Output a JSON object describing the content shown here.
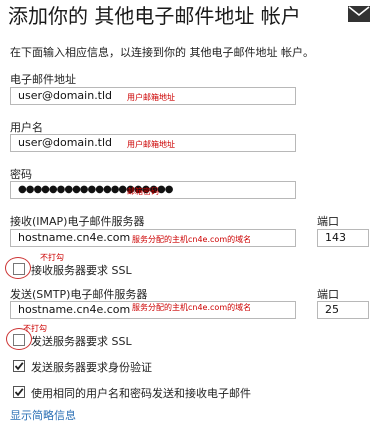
{
  "header": {
    "title": "添加你的 其他电子邮件地址 帐户",
    "mail_icon": "mail-envelope-icon"
  },
  "description": "在下面输入相应信息，以连接到你的 其他电子邮件地址 帐户。",
  "email": {
    "label": "电子邮件地址",
    "value": "user@domain.tld",
    "annotation": "用户邮箱地址"
  },
  "username": {
    "label": "用户名",
    "value": "user@domain.tld",
    "annotation": "用户邮箱地址"
  },
  "password": {
    "label": "密码",
    "value": "●●●●●●●●●●●●●●●●●●●●",
    "annotation": "邮箱密码"
  },
  "imap": {
    "label": "接收(IMAP)电子邮件服务器",
    "value": "hostname.cn4e.com",
    "annotation": "服务分配的主机cn4e.com的域名",
    "port_label": "端口",
    "port_value": "143"
  },
  "imap_ssl": {
    "label": "接收服务器要求 SSL",
    "checked": false,
    "annotation": "不打勾"
  },
  "smtp": {
    "label": "发送(SMTP)电子邮件服务器",
    "value": "hostname.cn4e.com",
    "annotation": "服务分配的主机cn4e.com的域名",
    "port_label": "端口",
    "port_value": "25"
  },
  "smtp_ssl": {
    "label": "发送服务器要求 SSL",
    "checked": false,
    "annotation": "不打勾"
  },
  "smtp_auth": {
    "label": "发送服务器要求身份验证",
    "checked": true
  },
  "same_credentials": {
    "label": "使用相同的用户名和密码发送和接收电子邮件",
    "checked": true
  },
  "show_less": "显示简略信息",
  "colors": {
    "annotation": "#cc0000",
    "link": "#2a6fb5"
  }
}
